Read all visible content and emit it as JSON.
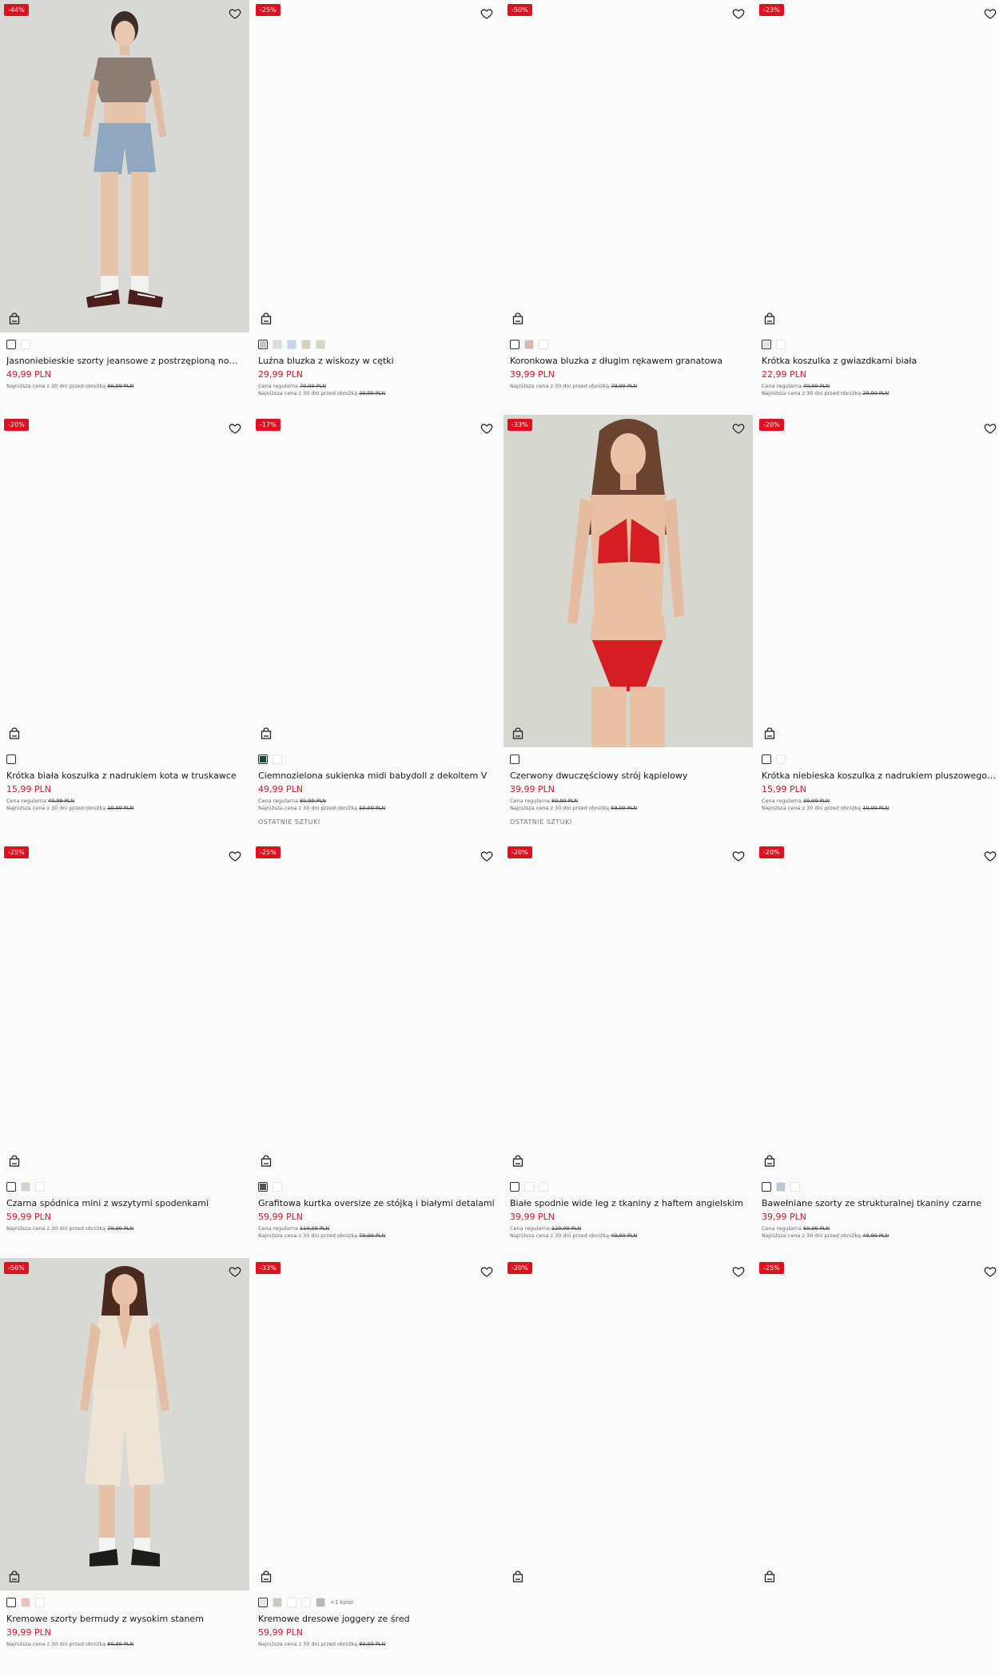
{
  "products": [
    {
      "badge": "-44%",
      "name": "Jasnoniebieskie szorty jeansowe z postrzępioną nogawką ...",
      "price": "49,99 PLN",
      "regular": "",
      "lowest_label": "Najniższa cena z 30 dni przed obniżką",
      "lowest_price": "89,99 PLN",
      "note": "",
      "swatches": [
        "#ffffff",
        "#ffffff"
      ],
      "photo": "model-shorts"
    },
    {
      "badge": "-25%",
      "name": "Luźna bluzka z wiskozy w cętki",
      "price": "29,99 PLN",
      "regular_label": "Cena regularna",
      "regular": "79,99 PLN",
      "lowest_label": "Najniższa cena z 30 dni przed obniżką",
      "lowest_price": "39,99 PLN",
      "note": "",
      "swatches": [
        "#bfc6c0",
        "#d8dde4",
        "#c7d6e6",
        "#d8d2b8",
        "#d6d8c4"
      ]
    },
    {
      "badge": "-50%",
      "name": "Koronkowa bluzka z długim rękawem granatowa",
      "price": "39,99 PLN",
      "regular": "",
      "lowest_label": "Najniższa cena z 30 dni przed obniżką",
      "lowest_price": "79,99 PLN",
      "note": "",
      "swatches": [
        "#ffffff",
        "#d8b8b0",
        "#ffffff"
      ]
    },
    {
      "badge": "-23%",
      "name": "Krótka koszulka z gwiazdkami biała",
      "price": "22,99 PLN",
      "regular_label": "Cena regularna",
      "regular": "49,99 PLN",
      "lowest_label": "Najniższa cena z 30 dni przed obniżką",
      "lowest_price": "29,99 PLN",
      "note": "",
      "swatches": [
        "#e3e3e3",
        "#ffffff"
      ]
    },
    {
      "badge": "-20%",
      "name": "Krótka biała koszulka z nadrukiem kota w truskawce",
      "price": "15,99 PLN",
      "regular_label": "Cena regularna",
      "regular": "49,99 PLN",
      "lowest_label": "Najniższa cena z 30 dni przed obniżką",
      "lowest_price": "19,99 PLN",
      "note": "",
      "swatches": [
        "#ffffff"
      ]
    },
    {
      "badge": "-17%",
      "name": "Ciemnozielona sukienka midi babydoll z dekoltem V",
      "price": "49,99 PLN",
      "regular_label": "Cena regularna",
      "regular": "89,99 PLN",
      "lowest_label": "Najniższa cena z 30 dni przed obniżką",
      "lowest_price": "59,99 PLN",
      "note": "OSTATNIE SZTUKI",
      "swatches": [
        "#0e4a3a",
        "#ffffff"
      ]
    },
    {
      "badge": "-33%",
      "name": "Czerwony dwuczęściowy strój kąpielowy",
      "price": "39,99 PLN",
      "regular_label": "Cena regularna",
      "regular": "89,99 PLN",
      "lowest_label": "Najniższa cena z 30 dni przed obniżką",
      "lowest_price": "59,99 PLN",
      "note": "OSTATNIE SZTUKI",
      "swatches": [
        "#ffffff"
      ],
      "photo": "model-bikini"
    },
    {
      "badge": "-20%",
      "name": "Krótka niebieska koszulka z nadrukiem pluszowego misia",
      "price": "15,99 PLN",
      "regular_label": "Cena regularna",
      "regular": "39,99 PLN",
      "lowest_label": "Najniższa cena z 30 dni przed obniżką",
      "lowest_price": "19,99 PLN",
      "note": "",
      "swatches": [
        "#ffffff",
        "#ffffff"
      ]
    },
    {
      "badge": "-25%",
      "name": "Czarna spódnica mini z wszytymi spodenkami",
      "price": "59,99 PLN",
      "regular": "",
      "lowest_label": "Najniższa cena z 30 dni przed obniżką",
      "lowest_price": "79,99 PLN",
      "note": "",
      "swatches": [
        "#ffffff",
        "#cfd6c8",
        "#ffffff"
      ]
    },
    {
      "badge": "-25%",
      "name": "Grafitowa kurtka oversize ze stójką i białymi detalami",
      "price": "59,99 PLN",
      "regular_label": "Cena regularna",
      "regular": "119,99 PLN",
      "lowest_label": "Najniższa cena z 30 dni przed obniżką",
      "lowest_price": "79,99 PLN",
      "note": "",
      "swatches": [
        "#555555",
        "#ffffff"
      ]
    },
    {
      "badge": "-20%",
      "name": "Białe spodnie wide leg z tkaniny z haftem angielskim",
      "price": "39,99 PLN",
      "regular_label": "Cena regularna",
      "regular": "129,99 PLN",
      "lowest_label": "Najniższa cena z 30 dni przed obniżką",
      "lowest_price": "49,99 PLN",
      "note": "",
      "swatches": [
        "#ffffff",
        "#ffffff",
        "#ffffff"
      ]
    },
    {
      "badge": "-20%",
      "name": "Bawełniane szorty ze strukturalnej tkaniny czarne",
      "price": "39,99 PLN",
      "regular_label": "Cena regularna",
      "regular": "69,99 PLN",
      "lowest_label": "Najniższa cena z 30 dni przed obniżką",
      "lowest_price": "49,99 PLN",
      "note": "",
      "swatches": [
        "#ffffff",
        "#b8c8d6",
        "#ffffff"
      ]
    },
    {
      "badge": "-56%",
      "name": "Kremowe szorty bermudy z wysokim stanem",
      "price": "39,99 PLN",
      "regular": "",
      "lowest_label": "Najniższa cena z 30 dni przed obniżką",
      "lowest_price": "89,99 PLN",
      "note": "",
      "swatches": [
        "#ffffff",
        "#e8c4bc",
        "#ffffff"
      ],
      "photo": "model-bermuda"
    },
    {
      "badge": "-33%",
      "name": "Kremowe dresowe joggery ze śred",
      "price": "59,99 PLN",
      "regular": "",
      "lowest_label": "Najniższa cena z 30 dni przed obniżką",
      "lowest_price": "89,99 PLN",
      "note": "",
      "swatches": [
        "#e8e6e0",
        "#c9c9bd",
        "#ffffff",
        "#ffffff",
        "#b8b8b8"
      ],
      "more": "+1 kolor"
    },
    {
      "badge": "-20%",
      "name": "",
      "price": "",
      "regular": "",
      "lowest_label": "",
      "lowest_price": "",
      "note": "",
      "swatches": []
    },
    {
      "badge": "-25%",
      "name": "",
      "price": "",
      "regular": "",
      "lowest_label": "",
      "lowest_price": "",
      "note": "",
      "swatches": []
    }
  ]
}
